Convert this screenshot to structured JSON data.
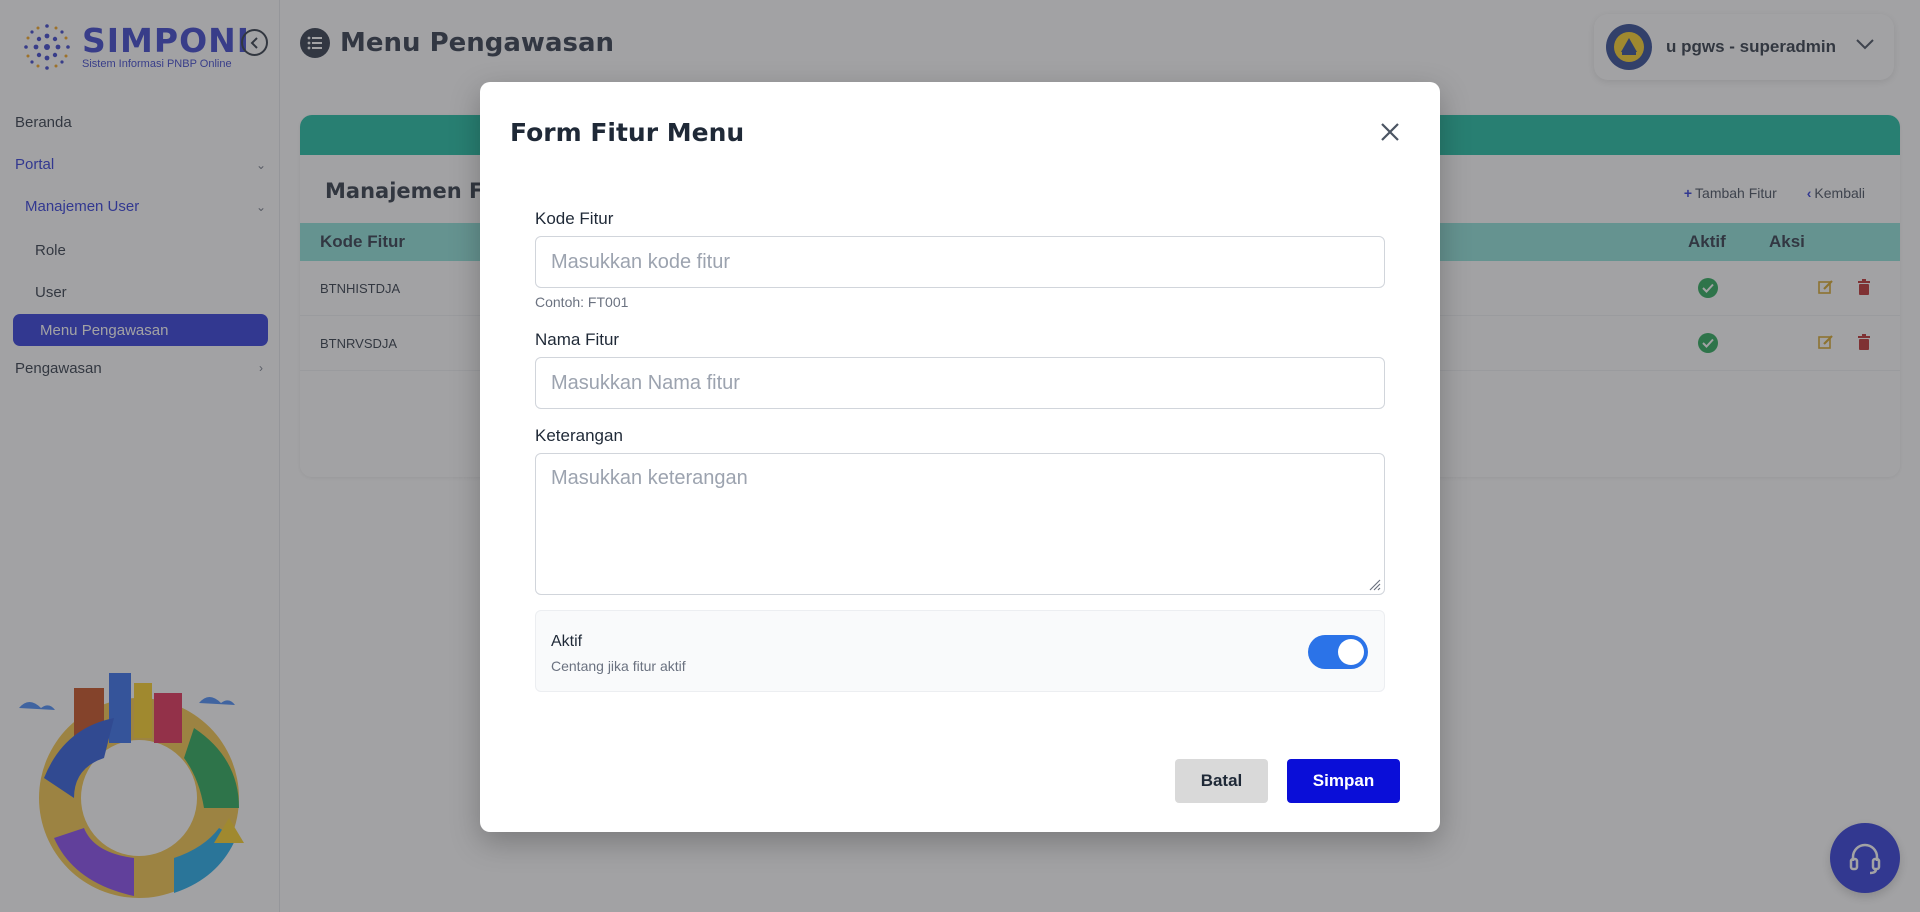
{
  "brand": {
    "name": "SIMPONI",
    "tagline": "Sistem Informasi PNBP Online",
    "color": "#2a35c9"
  },
  "sidebar": {
    "items": [
      {
        "label": "Beranda"
      },
      {
        "label": "Portal"
      },
      {
        "label": "Manajemen User"
      },
      {
        "label": "Role"
      },
      {
        "label": "User"
      },
      {
        "label": "Menu Pengawasan"
      },
      {
        "label": "Pengawasan"
      }
    ],
    "active_color": "#1e2ad6"
  },
  "header": {
    "title": "Menu Pengawasan",
    "user": "u pgws - superadmin"
  },
  "card": {
    "title": "Manajemen Fit",
    "actions": {
      "add": "Tambah Fitur",
      "back": "Kembali"
    },
    "columns": {
      "code": "Kode Fitur",
      "active": "Aktif",
      "action": "Aksi"
    },
    "rows": [
      {
        "code": "BTNHISTDJA",
        "active": true
      },
      {
        "code": "BTNRVSDJA",
        "active": true
      }
    ],
    "accent": "#0bb89b"
  },
  "modal": {
    "title": "Form Fitur Menu",
    "kode": {
      "label": "Kode Fitur",
      "placeholder": "Masukkan kode fitur",
      "hint": "Contoh: FT001"
    },
    "nama": {
      "label": "Nama Fitur",
      "placeholder": "Masukkan Nama fitur"
    },
    "keterangan": {
      "label": "Keterangan",
      "placeholder": "Masukkan keterangan"
    },
    "aktif": {
      "label": "Aktif",
      "description": "Centang jika fitur aktif",
      "checked": true
    },
    "buttons": {
      "cancel": "Batal",
      "save": "Simpan"
    },
    "primary_color": "#0a0ed8"
  }
}
